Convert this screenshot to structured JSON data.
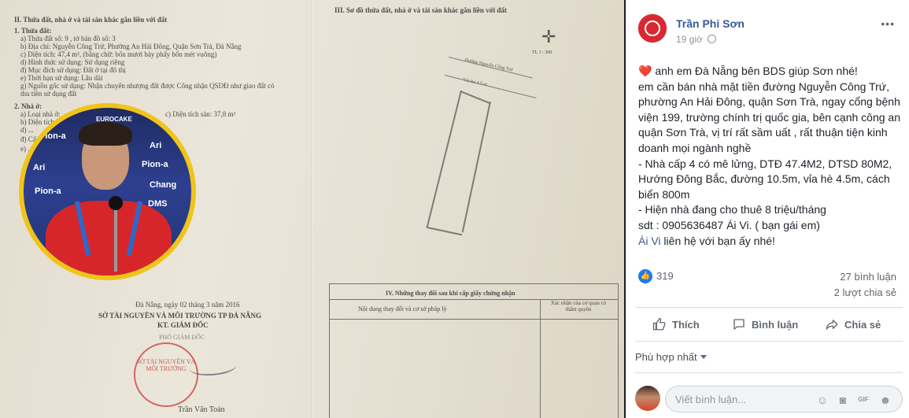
{
  "document": {
    "left_section_title": "II. Thửa đất, nhà ở và tài sản khác gắn liền với đất",
    "land": {
      "header": "1. Thửa đất:",
      "lines": [
        "a) Thửa đất số:   9                                , tờ bản đồ số:   3",
        "b) Địa chỉ:        Nguyễn Công Trứ, Phường An Hải Đông, Quận Sơn Trà, Đà Nẵng",
        "c) Diện tích:      47,4 m², (bằng chữ: bốn mươi bảy phẩy bốn mét vuông)",
        "d) Hình thức sử dụng:   Sử dụng riêng",
        "đ) Mục đích sử dụng:  Đất ở tại đô thị",
        "e) Thời hạn sử dụng:   Lâu dài",
        "g) Nguồn gốc sử dụng:  Nhận chuyển nhượng đất được Công nhận QSDĐ như giao đất có",
        "    thu tiền sử dụng đất"
      ]
    },
    "house": {
      "header": "2. Nhà ở:",
      "lines": [
        "a) Loại nhà ở:",
        "b) Diện tích",
        "c) Diện tích sàn:   37,8 m²",
        "d) ...",
        "đ) Cấp ...",
        "e) ..."
      ]
    },
    "right_section_title": "III. Sơ đồ thửa đất, nhà ở và tài sản khác gắn liền với đất",
    "street_label": "Đường Nguyễn Công Trứ",
    "sidewalk_label": "Vỉa hè 4.5 m",
    "north_label": "TL 1 : 300",
    "changes_title": "IV. Những thay đổi sau khi cấp giấy chứng nhận",
    "changes_col1": "Nội dung thay đổi và cơ sở pháp lý",
    "changes_col2": "Xác nhận của cơ quan có thẩm quyền",
    "date_line": "Đà Nẵng, ngày  02  tháng  3  năm 2016",
    "agency": "SỞ TÀI NGUYÊN VÀ MÔI TRƯỜNG TP ĐÀ NẴNG",
    "director": "KT. GIÁM ĐỐC",
    "deputy": "PHÓ GIÁM ĐỐC",
    "stamp_text": "SỞ TÀI NGUYÊN VÀ MÔI TRƯỜNG",
    "signer": "Trần Văn Toản",
    "sponsors": [
      "EUROCAKE",
      "Pion-a",
      "Ari",
      "Pion-a",
      "Ari",
      "Chang",
      "Pion-a",
      "DMS"
    ]
  },
  "post": {
    "author": "Trần Phi Sơn",
    "time": "19 giờ",
    "more_label": "•••",
    "paragraph1_heart": "❤️",
    "paragraph1": " anh em Đà Nẵng bên BDS giúp Sơn nhé!",
    "paragraph2": "em cần bán nhà mặt tiền đường Nguyễn Công Trứ, phường An Hải Đông, quận Sơn Trà, ngay cổng bệnh viện 199, trường chính trị quốc gia, bên cạnh công an quận Sơn Trà, vị trí rất sầm uất , rất thuận tiện kinh doanh mọi ngành nghề",
    "paragraph3": "- Nhà cấp 4 có mê lửng, DTĐ 47.4M2, DTSD 80M2, Hướng Đông Bắc, đường 10.5m, vỉa hè 4.5m, cách biển 800m",
    "paragraph4": "- Hiện nhà đang cho thuê 8 triệu/tháng",
    "paragraph5": "sdt : 0905636487 Ái Vi. ( bạn gái em)",
    "mention": "Ái Vi",
    "paragraph6": " liên hệ với bạn ấy nhé!",
    "reactions_count": "319",
    "comments_count": "27 bình luận",
    "shares_count": "2 lượt chia sẻ",
    "actions": {
      "like": "Thích",
      "comment": "Bình luận",
      "share": "Chia sẻ"
    },
    "sort_label": "Phù hợp nhất",
    "comment_placeholder": "Viết bình luận..."
  },
  "colors": {
    "link": "#385898",
    "like_blue": "#2078f4",
    "heart": "#e0245e",
    "stamp_red": "#c93c3c",
    "frame_yellow": "#f0c419"
  }
}
